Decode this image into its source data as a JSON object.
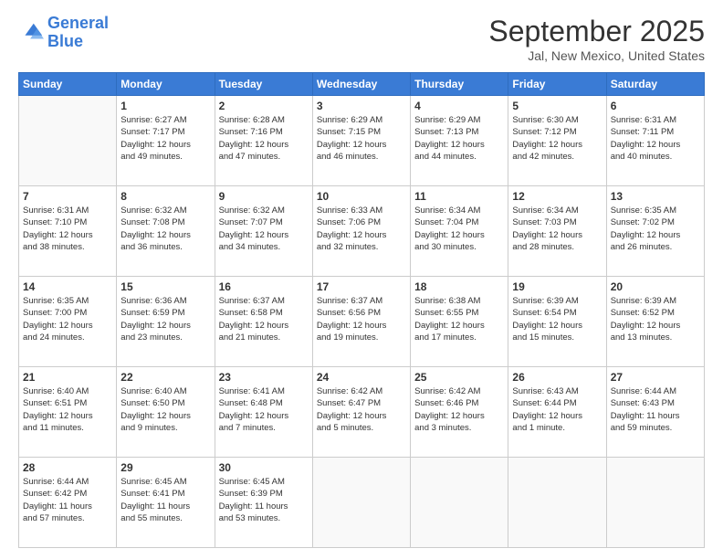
{
  "logo": {
    "line1": "General",
    "line2": "Blue"
  },
  "title": "September 2025",
  "subtitle": "Jal, New Mexico, United States",
  "weekdays": [
    "Sunday",
    "Monday",
    "Tuesday",
    "Wednesday",
    "Thursday",
    "Friday",
    "Saturday"
  ],
  "weeks": [
    [
      {
        "day": "",
        "info": ""
      },
      {
        "day": "1",
        "info": "Sunrise: 6:27 AM\nSunset: 7:17 PM\nDaylight: 12 hours\nand 49 minutes."
      },
      {
        "day": "2",
        "info": "Sunrise: 6:28 AM\nSunset: 7:16 PM\nDaylight: 12 hours\nand 47 minutes."
      },
      {
        "day": "3",
        "info": "Sunrise: 6:29 AM\nSunset: 7:15 PM\nDaylight: 12 hours\nand 46 minutes."
      },
      {
        "day": "4",
        "info": "Sunrise: 6:29 AM\nSunset: 7:13 PM\nDaylight: 12 hours\nand 44 minutes."
      },
      {
        "day": "5",
        "info": "Sunrise: 6:30 AM\nSunset: 7:12 PM\nDaylight: 12 hours\nand 42 minutes."
      },
      {
        "day": "6",
        "info": "Sunrise: 6:31 AM\nSunset: 7:11 PM\nDaylight: 12 hours\nand 40 minutes."
      }
    ],
    [
      {
        "day": "7",
        "info": "Sunrise: 6:31 AM\nSunset: 7:10 PM\nDaylight: 12 hours\nand 38 minutes."
      },
      {
        "day": "8",
        "info": "Sunrise: 6:32 AM\nSunset: 7:08 PM\nDaylight: 12 hours\nand 36 minutes."
      },
      {
        "day": "9",
        "info": "Sunrise: 6:32 AM\nSunset: 7:07 PM\nDaylight: 12 hours\nand 34 minutes."
      },
      {
        "day": "10",
        "info": "Sunrise: 6:33 AM\nSunset: 7:06 PM\nDaylight: 12 hours\nand 32 minutes."
      },
      {
        "day": "11",
        "info": "Sunrise: 6:34 AM\nSunset: 7:04 PM\nDaylight: 12 hours\nand 30 minutes."
      },
      {
        "day": "12",
        "info": "Sunrise: 6:34 AM\nSunset: 7:03 PM\nDaylight: 12 hours\nand 28 minutes."
      },
      {
        "day": "13",
        "info": "Sunrise: 6:35 AM\nSunset: 7:02 PM\nDaylight: 12 hours\nand 26 minutes."
      }
    ],
    [
      {
        "day": "14",
        "info": "Sunrise: 6:35 AM\nSunset: 7:00 PM\nDaylight: 12 hours\nand 24 minutes."
      },
      {
        "day": "15",
        "info": "Sunrise: 6:36 AM\nSunset: 6:59 PM\nDaylight: 12 hours\nand 23 minutes."
      },
      {
        "day": "16",
        "info": "Sunrise: 6:37 AM\nSunset: 6:58 PM\nDaylight: 12 hours\nand 21 minutes."
      },
      {
        "day": "17",
        "info": "Sunrise: 6:37 AM\nSunset: 6:56 PM\nDaylight: 12 hours\nand 19 minutes."
      },
      {
        "day": "18",
        "info": "Sunrise: 6:38 AM\nSunset: 6:55 PM\nDaylight: 12 hours\nand 17 minutes."
      },
      {
        "day": "19",
        "info": "Sunrise: 6:39 AM\nSunset: 6:54 PM\nDaylight: 12 hours\nand 15 minutes."
      },
      {
        "day": "20",
        "info": "Sunrise: 6:39 AM\nSunset: 6:52 PM\nDaylight: 12 hours\nand 13 minutes."
      }
    ],
    [
      {
        "day": "21",
        "info": "Sunrise: 6:40 AM\nSunset: 6:51 PM\nDaylight: 12 hours\nand 11 minutes."
      },
      {
        "day": "22",
        "info": "Sunrise: 6:40 AM\nSunset: 6:50 PM\nDaylight: 12 hours\nand 9 minutes."
      },
      {
        "day": "23",
        "info": "Sunrise: 6:41 AM\nSunset: 6:48 PM\nDaylight: 12 hours\nand 7 minutes."
      },
      {
        "day": "24",
        "info": "Sunrise: 6:42 AM\nSunset: 6:47 PM\nDaylight: 12 hours\nand 5 minutes."
      },
      {
        "day": "25",
        "info": "Sunrise: 6:42 AM\nSunset: 6:46 PM\nDaylight: 12 hours\nand 3 minutes."
      },
      {
        "day": "26",
        "info": "Sunrise: 6:43 AM\nSunset: 6:44 PM\nDaylight: 12 hours\nand 1 minute."
      },
      {
        "day": "27",
        "info": "Sunrise: 6:44 AM\nSunset: 6:43 PM\nDaylight: 11 hours\nand 59 minutes."
      }
    ],
    [
      {
        "day": "28",
        "info": "Sunrise: 6:44 AM\nSunset: 6:42 PM\nDaylight: 11 hours\nand 57 minutes."
      },
      {
        "day": "29",
        "info": "Sunrise: 6:45 AM\nSunset: 6:41 PM\nDaylight: 11 hours\nand 55 minutes."
      },
      {
        "day": "30",
        "info": "Sunrise: 6:45 AM\nSunset: 6:39 PM\nDaylight: 11 hours\nand 53 minutes."
      },
      {
        "day": "",
        "info": ""
      },
      {
        "day": "",
        "info": ""
      },
      {
        "day": "",
        "info": ""
      },
      {
        "day": "",
        "info": ""
      }
    ]
  ]
}
